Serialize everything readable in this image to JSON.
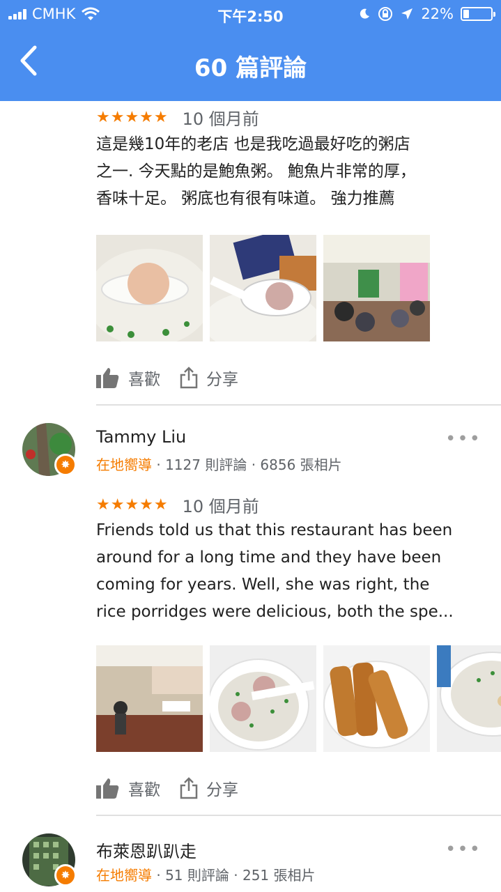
{
  "status_bar": {
    "carrier": "CMHK",
    "time": "下午2:50",
    "battery_percent": "22%",
    "battery_level": 0.22
  },
  "app_bar": {
    "title": "60 篇評論"
  },
  "review1": {
    "stars": "★★★★★",
    "date": "10 個月前",
    "text_lines": [
      "這是幾10年的老店 也是我吃過最好吃的粥店",
      "之一. 今天點的是鮑魚粥。 鮑魚片非常的厚，",
      "香味十足。 粥底也有很有味道。 強力推薦"
    ],
    "like_label": "喜歡",
    "share_label": "分享"
  },
  "review2": {
    "reviewer_name": "Tammy Liu",
    "guide_label": "在地嚮導",
    "review_count": "1127 則評論",
    "photo_count": "6856 張相片",
    "stars": "★★★★★",
    "date": "10 個月前",
    "text_lines": [
      "Friends told us that this restaurant has been",
      "around for a long time and they have been",
      "coming for years.  Well, she was right, the",
      "rice porridges were delicious, both the spe..."
    ],
    "like_label": "喜歡",
    "share_label": "分享"
  },
  "review3": {
    "reviewer_name": "布萊恩趴趴走",
    "guide_label": "在地嚮導",
    "review_count": "51 則評論",
    "photo_count": "251 張相片"
  },
  "colors": {
    "app_bar": "#4a8ef0",
    "star": "#f57c00",
    "guide": "#f57c00"
  }
}
